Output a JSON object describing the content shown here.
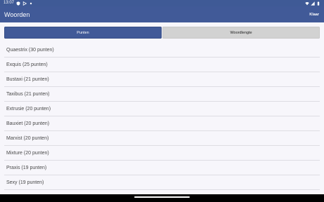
{
  "status_bar": {
    "time": "13:07",
    "left_icons": [
      "shield-icon",
      "play-store-icon",
      "dot-icon"
    ],
    "right_icons": [
      "wifi-icon",
      "signal-icon",
      "battery-icon"
    ]
  },
  "app_bar": {
    "title": "Woorden",
    "done_label": "Klaar"
  },
  "tabs": [
    {
      "label": "Punten",
      "active": true
    },
    {
      "label": "Woordlengte",
      "active": false
    }
  ],
  "words": [
    {
      "text": "Quaestrix (30 punten)"
    },
    {
      "text": "Exquis (25 punten)"
    },
    {
      "text": "Bustaxi (21 punten)"
    },
    {
      "text": "Taxibus (21 punten)"
    },
    {
      "text": "Extrusie (20 punten)"
    },
    {
      "text": "Bauxiet (20 punten)"
    },
    {
      "text": "Marxist (20 punten)"
    },
    {
      "text": "Mixture (20 punten)"
    },
    {
      "text": "Praxis (19 punten)"
    },
    {
      "text": "Sexy (19 punten)"
    }
  ],
  "colors": {
    "primary": "#415a98",
    "background": "#f7f6fb",
    "inactive_tab": "#d2d2d2"
  }
}
